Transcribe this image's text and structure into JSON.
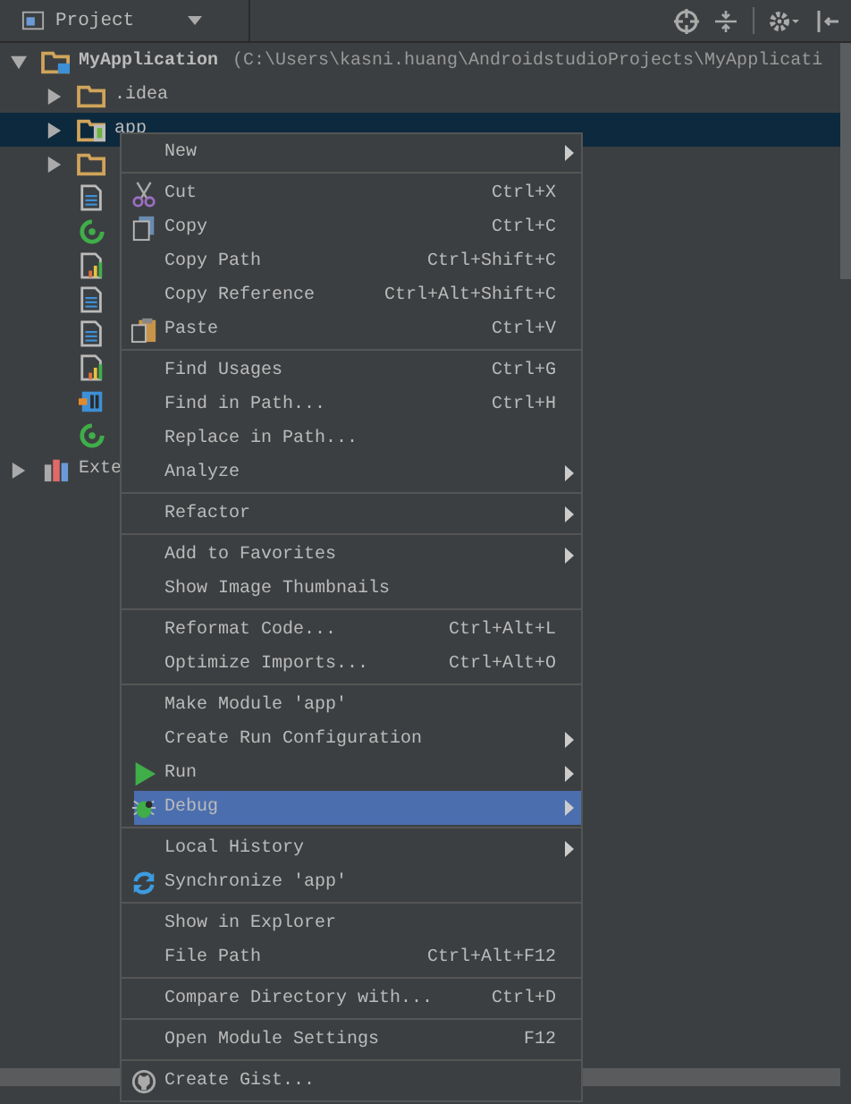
{
  "header": {
    "title": "Project"
  },
  "tree": [
    {
      "label": "MyApplication",
      "path": "(C:\\Users\\kasni.huang\\AndroidstudioProjects\\MyApplicati",
      "kind": "project",
      "expanded": true,
      "selected": false,
      "children": [
        {
          "label": ".idea",
          "kind": "folder",
          "expanded": false,
          "selected": false
        },
        {
          "label": "app",
          "kind": "module",
          "expanded": false,
          "selected": true
        },
        {
          "kind": "folder",
          "expanded": false,
          "selected": false
        },
        {
          "kind": "file",
          "selected": false
        },
        {
          "kind": "gradle",
          "selected": false
        },
        {
          "kind": "chart",
          "selected": false
        },
        {
          "kind": "file",
          "selected": false
        },
        {
          "kind": "file",
          "selected": false
        },
        {
          "kind": "chart",
          "selected": false
        },
        {
          "kind": "idea",
          "selected": false
        },
        {
          "kind": "gradle",
          "selected": false
        }
      ]
    },
    {
      "label": "Exte",
      "kind": "library",
      "expanded": false,
      "selected": false
    }
  ],
  "menu": {
    "groups": [
      [
        {
          "label": "New",
          "submenu": true,
          "selected": false
        }
      ],
      [
        {
          "label": "Cut",
          "shortcut": "Ctrl+X",
          "kind": "cut",
          "selected": false
        },
        {
          "label": "Copy",
          "shortcut": "Ctrl+C",
          "kind": "copy",
          "selected": false
        },
        {
          "label": "Copy Path",
          "shortcut": "Ctrl+Shift+C",
          "selected": false
        },
        {
          "label": "Copy Reference",
          "shortcut": "Ctrl+Alt+Shift+C",
          "selected": false
        },
        {
          "label": "Paste",
          "shortcut": "Ctrl+V",
          "kind": "paste",
          "selected": false
        }
      ],
      [
        {
          "label": "Find Usages",
          "shortcut": "Ctrl+G",
          "selected": false
        },
        {
          "label": "Find in Path...",
          "shortcut": "Ctrl+H",
          "selected": false
        },
        {
          "label": "Replace in Path...",
          "selected": false
        },
        {
          "label": "Analyze",
          "submenu": true,
          "selected": false
        }
      ],
      [
        {
          "label": "Refactor",
          "submenu": true,
          "selected": false
        }
      ],
      [
        {
          "label": "Add to Favorites",
          "submenu": true,
          "selected": false
        },
        {
          "label": "Show Image Thumbnails",
          "selected": false
        }
      ],
      [
        {
          "label": "Reformat Code...",
          "shortcut": "Ctrl+Alt+L",
          "selected": false
        },
        {
          "label": "Optimize Imports...",
          "shortcut": "Ctrl+Alt+O",
          "selected": false
        }
      ],
      [
        {
          "label": "Make Module 'app'",
          "selected": false
        },
        {
          "label": "Create Run Configuration",
          "submenu": true,
          "selected": false
        },
        {
          "label": "Run",
          "submenu": true,
          "kind": "run",
          "selected": false
        },
        {
          "label": "Debug",
          "submenu": true,
          "kind": "debug",
          "selected": true
        }
      ],
      [
        {
          "label": "Local History",
          "submenu": true,
          "selected": false
        },
        {
          "label": "Synchronize 'app'",
          "kind": "sync",
          "selected": false
        }
      ],
      [
        {
          "label": "Show in Explorer",
          "selected": false
        },
        {
          "label": "File Path",
          "shortcut": "Ctrl+Alt+F12",
          "selected": false
        }
      ],
      [
        {
          "label": "Compare Directory with...",
          "shortcut": "Ctrl+D",
          "selected": false
        }
      ],
      [
        {
          "label": "Open Module Settings",
          "shortcut": "F12",
          "selected": false
        }
      ],
      [
        {
          "label": "Create Gist...",
          "kind": "github",
          "selected": false
        }
      ]
    ]
  }
}
